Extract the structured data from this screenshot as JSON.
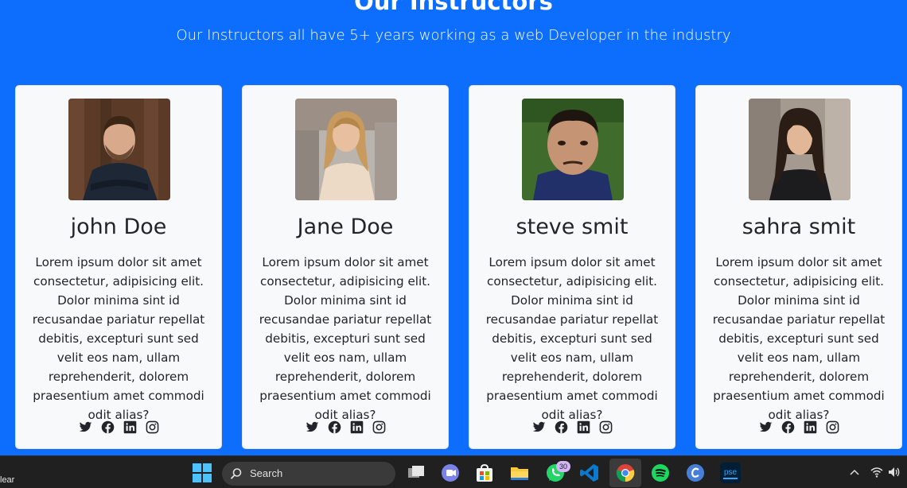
{
  "section": {
    "title": "Our Instructors",
    "subtitle": "Our Instructors all have 5+ years working as a web Developer in the industry"
  },
  "instructors": [
    {
      "name": "john Doe",
      "bio": "Lorem ipsum dolor sit amet consectetur, adipisicing elit. Dolor minima sint id recusandae pariatur repellat debitis, excepturi sunt sed velit eos nam, ullam reprehenderit, dolorem praesentium amet commodi odit alias?",
      "photo": "man-with-beard-photo"
    },
    {
      "name": "Jane Doe",
      "bio": "Lorem ipsum dolor sit amet consectetur, adipisicing elit. Dolor minima sint id recusandae pariatur repellat debitis, excepturi sunt sed velit eos nam, ullam reprehenderit, dolorem praesentium amet commodi odit alias?",
      "photo": "blonde-woman-photo"
    },
    {
      "name": "steve smit",
      "bio": "Lorem ipsum dolor sit amet consectetur, adipisicing elit. Dolor minima sint id recusandae pariatur repellat debitis, excepturi sunt sed velit eos nam, ullam reprehenderit, dolorem praesentium amet commodi odit alias?",
      "photo": "man-selfie-photo"
    },
    {
      "name": "sahra smit",
      "bio": "Lorem ipsum dolor sit amet consectetur, adipisicing elit. Dolor minima sint id recusandae pariatur repellat debitis, excepturi sunt sed velit eos nam, ullam reprehenderit, dolorem praesentium amet commodi odit alias?",
      "photo": "dark-haired-woman-photo"
    }
  ],
  "social_icons": [
    "twitter-icon",
    "facebook-icon",
    "linkedin-icon",
    "instagram-icon"
  ],
  "taskbar": {
    "weather_text": "lear",
    "search_label": "Search",
    "whatsapp_badge": "30",
    "apps": [
      "windows-start-icon",
      "task-view-icon",
      "teams-icon",
      "store-icon",
      "file-explorer-icon",
      "whatsapp-icon",
      "vscode-icon",
      "chrome-icon",
      "spotify-icon",
      "canva-icon",
      "photoshop-icon"
    ],
    "photoshop_label": "pse"
  },
  "colors": {
    "primary": "#0d6efd",
    "card": "#f8f9fa",
    "text": "#212529",
    "taskbar": "#202020"
  }
}
